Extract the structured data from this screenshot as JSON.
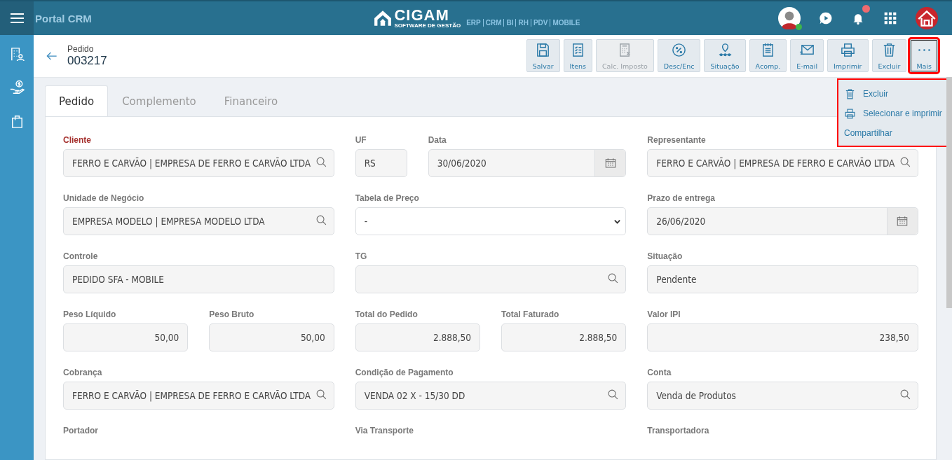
{
  "topbar": {
    "title": "Portal CRM",
    "logo_text": "CIGAM",
    "logo_subtitle": "SOFTWARE DE GESTÃO",
    "modules": [
      "ERP",
      "CRM",
      "BI",
      "RH",
      "PDV",
      "MOBILE"
    ],
    "notifications_unread": true,
    "user_online": true
  },
  "sidebar": {
    "items": [
      {
        "kind": "contacts",
        "selected": false
      },
      {
        "kind": "money",
        "selected": false
      },
      {
        "kind": "bag",
        "selected": false
      }
    ]
  },
  "header": {
    "caption": "Pedido",
    "number": "003217"
  },
  "toolbar": [
    {
      "kind": "save",
      "label": "Salvar",
      "disabled": false,
      "highlighted": false
    },
    {
      "kind": "list",
      "label": "Itens",
      "disabled": false,
      "highlighted": false
    },
    {
      "kind": "calc",
      "label": "Calc. Imposto",
      "disabled": true,
      "highlighted": false
    },
    {
      "kind": "percent",
      "label": "Desc/Enc",
      "disabled": false,
      "highlighted": false
    },
    {
      "kind": "status",
      "label": "Situação",
      "disabled": false,
      "highlighted": false
    },
    {
      "kind": "notes",
      "label": "Acomp.",
      "disabled": false,
      "highlighted": false
    },
    {
      "kind": "mail",
      "label": "E-mail",
      "disabled": false,
      "highlighted": false
    },
    {
      "kind": "print",
      "label": "Imprimir",
      "disabled": false,
      "highlighted": false
    },
    {
      "kind": "trash",
      "label": "Excluir",
      "disabled": false,
      "highlighted": false
    },
    {
      "kind": "more",
      "label": "Mais",
      "disabled": false,
      "highlighted": true
    }
  ],
  "more_menu": {
    "highlighted": true,
    "items": [
      {
        "kind": "trash",
        "label": "Excluir"
      },
      {
        "kind": "print",
        "label": "Selecionar e imprimir"
      },
      {
        "kind": "none",
        "label": "Compartilhar"
      }
    ]
  },
  "tabs": [
    {
      "label": "Pedido",
      "selected": true
    },
    {
      "label": "Complemento",
      "selected": false
    },
    {
      "label": "Financeiro",
      "selected": false
    }
  ],
  "form": [
    [
      [
        {
          "label": "Cliente",
          "required": true,
          "kind": "search",
          "value": "FERRO E CARVÃO | EMPRESA DE FERRO E CARVÃO LTDA"
        }
      ],
      [
        {
          "label": "UF",
          "required": false,
          "kind": "text",
          "value": "RS"
        },
        {
          "label": "Data",
          "required": false,
          "kind": "date",
          "value": "30/06/2020"
        }
      ],
      [
        {
          "label": "Representante",
          "required": false,
          "kind": "search",
          "value": "FERRO E CARVÃO | EMPRESA DE FERRO E CARVÃO LTDA"
        }
      ]
    ],
    [
      [
        {
          "label": "Unidade de Negócio",
          "required": false,
          "kind": "search",
          "value": "EMPRESA MODELO | EMPRESA MODELO LTDA"
        }
      ],
      [
        {
          "label": "Tabela de Preço",
          "required": false,
          "kind": "select",
          "value": "-"
        }
      ],
      [
        {
          "label": "Prazo de entrega",
          "required": false,
          "kind": "date",
          "value": "26/06/2020"
        }
      ]
    ],
    [
      [
        {
          "label": "Controle",
          "required": false,
          "kind": "text",
          "value": "PEDIDO SFA - MOBILE"
        }
      ],
      [
        {
          "label": "TG",
          "required": false,
          "kind": "search"
        }
      ],
      [
        {
          "label": "Situação",
          "required": false,
          "kind": "text",
          "value": "Pendente"
        }
      ]
    ],
    [
      [
        {
          "label": "Peso Líquido",
          "required": false,
          "kind": "number",
          "value": "50,00"
        },
        {
          "label": "Peso Bruto",
          "required": false,
          "kind": "number",
          "value": "50,00"
        }
      ],
      [
        {
          "label": "Total do Pedido",
          "required": false,
          "kind": "number",
          "value": "2.888,50"
        },
        {
          "label": "Total Faturado",
          "required": false,
          "kind": "number",
          "value": "2.888,50"
        }
      ],
      [
        {
          "label": "Valor IPI",
          "required": false,
          "kind": "number",
          "value": "238,50"
        }
      ]
    ],
    [
      [
        {
          "label": "Cobrança",
          "required": false,
          "kind": "search",
          "value": "FERRO E CARVÃO | EMPRESA DE FERRO E CARVÃO LTDA"
        }
      ],
      [
        {
          "label": "Condição de Pagamento",
          "required": false,
          "kind": "search",
          "value": "VENDA 02 X - 15/30 DD"
        }
      ],
      [
        {
          "label": "Conta",
          "required": false,
          "kind": "search",
          "value": "Venda de Produtos"
        }
      ]
    ],
    [
      [
        {
          "label": "Portador",
          "required": false,
          "kind": "hidden"
        }
      ],
      [
        {
          "label": "Via Transporte",
          "required": false,
          "kind": "hidden"
        }
      ],
      [
        {
          "label": "Transportadora",
          "required": false,
          "kind": "hidden"
        }
      ]
    ]
  ]
}
